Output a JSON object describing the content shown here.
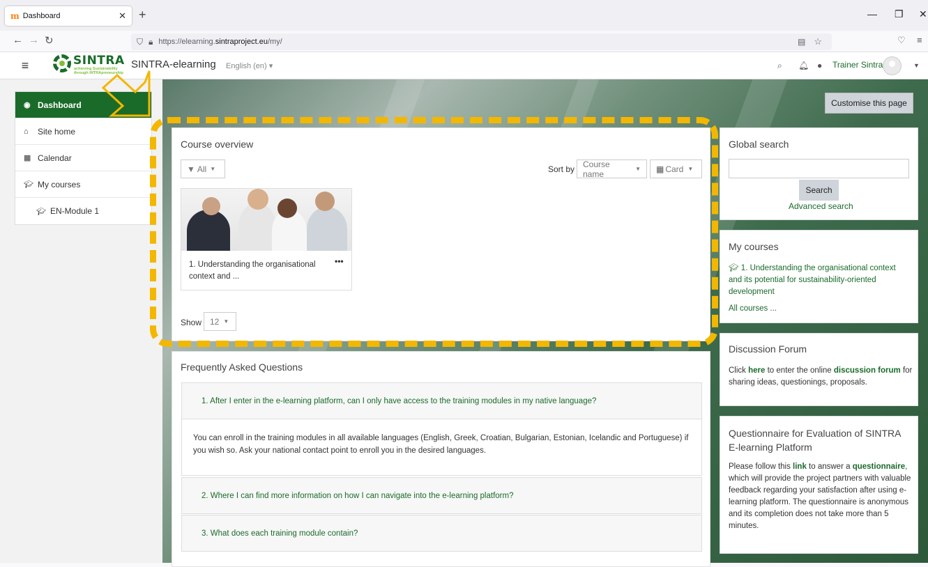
{
  "browser": {
    "tab_title": "Dashboard",
    "tab_favicon": "m",
    "url_prefix": "https://elearning.",
    "url_domain": "sintraproject.eu",
    "url_path": "/my/"
  },
  "navbar": {
    "logo_word": "SINTRA",
    "logo_sub1": "achieving Sustainability",
    "logo_sub2": "through INTRApreneurship",
    "site_title": "SINTRA-elearning",
    "language": "English (en) ▾",
    "username": "Trainer Sintra"
  },
  "drawer": {
    "items": [
      {
        "label": "Dashboard",
        "icon": "dashboard-icon"
      },
      {
        "label": "Site home",
        "icon": "home-icon"
      },
      {
        "label": "Calendar",
        "icon": "calendar-icon"
      },
      {
        "label": "My courses",
        "icon": "graduation-cap-icon"
      },
      {
        "label": "EN-Module 1",
        "icon": "graduation-cap-icon"
      }
    ]
  },
  "customise_label": "Customise this page",
  "course_overview": {
    "title": "Course overview",
    "filter": "All",
    "sort_by_label": "Sort by",
    "sort_value": "Course name",
    "view_value": "Card",
    "course_title_line1": "1. Understanding the organisational",
    "course_title_line2": "context and ...",
    "show_label": "Show",
    "show_value": "12"
  },
  "faq": {
    "title": "Frequently Asked Questions",
    "q1": "1. After I enter in the e-learning platform, can I only have access to the training modules in my native language?",
    "a1": "You can enroll in the training modules in all available languages (English, Greek, Croatian, Bulgarian, Estonian, Icelandic and Portuguese) if you wish so. Ask your national contact point to enroll you in the desired languages.",
    "q2": "2. Where I can find more information on how I can navigate into the e-learning platform?",
    "q3": "3. What does each training module contain?"
  },
  "global_search": {
    "title": "Global search",
    "button": "Search",
    "advanced": "Advanced search"
  },
  "my_courses": {
    "title": "My courses",
    "course": "1. Understanding the organisational context and its potential for sustainability-oriented development",
    "all": "All courses ..."
  },
  "forum": {
    "title": "Discussion Forum",
    "t1": "Click ",
    "here": "here",
    "t2": " to enter the online ",
    "link": "discussion forum",
    "t3": " for sharing ideas, questionings, proposals."
  },
  "questionnaire": {
    "title": "Questionnaire for Evaluation of SINTRA E-learning Platform",
    "t1": "Please follow this ",
    "link": "link",
    "t2": " to answer a ",
    "q": "questionnaire",
    "t3": ", which will provide the project partners with valuable feedback regarding your satisfaction after using e-learning platform. The questionnaire is anonymous and its completion does not take more than 5 minutes."
  },
  "colors": {
    "brand": "#1a6b2a",
    "annotation": "#f3b700"
  }
}
